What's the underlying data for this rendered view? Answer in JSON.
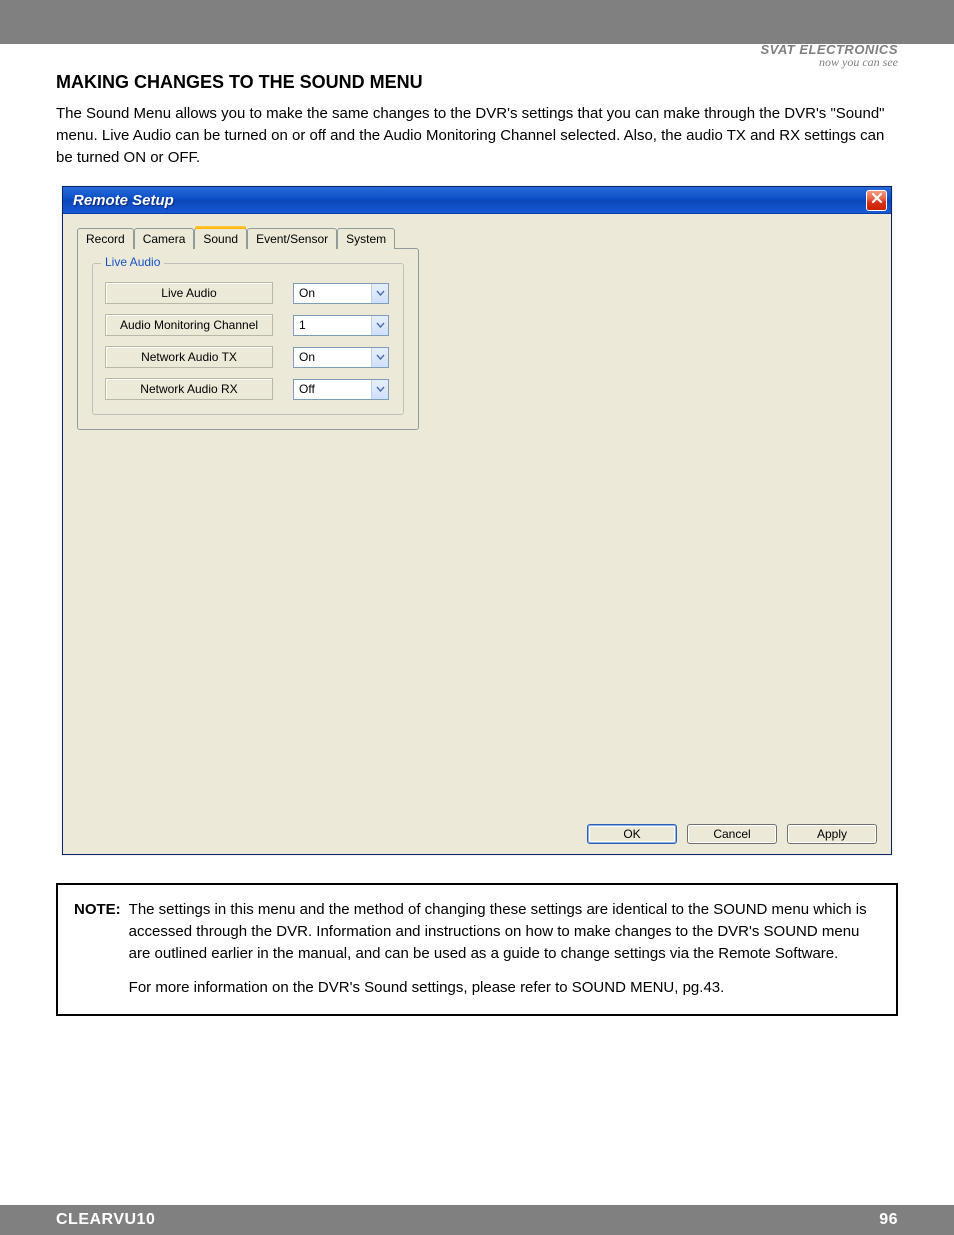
{
  "brand": {
    "name": "SVAT ELECTRONICS",
    "tagline": "now you can see"
  },
  "heading": "MAKING CHANGES TO THE SOUND MENU",
  "intro": "The Sound Menu allows you to make the same changes to the DVR's settings that you can make through the DVR's \"Sound\" menu.  Live Audio can be turned on or off and the Audio Monitoring Channel selected.  Also, the audio TX and RX settings can be turned ON or OFF.",
  "dialog": {
    "title": "Remote Setup",
    "tabs": [
      "Record",
      "Camera",
      "Sound",
      "Event/Sensor",
      "System"
    ],
    "activeTab": "Sound",
    "fieldsetTitle": "Live Audio",
    "rows": [
      {
        "label": "Live Audio",
        "value": "On"
      },
      {
        "label": "Audio Monitoring Channel",
        "value": "1"
      },
      {
        "label": "Network Audio TX",
        "value": "On"
      },
      {
        "label": "Network Audio RX",
        "value": "Off"
      }
    ],
    "buttons": {
      "ok": "OK",
      "cancel": "Cancel",
      "apply": "Apply"
    }
  },
  "note": {
    "label": "NOTE:",
    "p1": "The settings in this menu and the method of changing these settings are identical to the SOUND menu which is accessed through the DVR.  Information and instructions on how to make changes to the DVR's SOUND menu are outlined earlier in the manual, and can be used as a guide to change settings via the Remote Software.",
    "p2": "For more information on the DVR's Sound settings, please refer to SOUND MENU, pg.43."
  },
  "footer": {
    "product": "CLEARVU10",
    "page": "96"
  }
}
